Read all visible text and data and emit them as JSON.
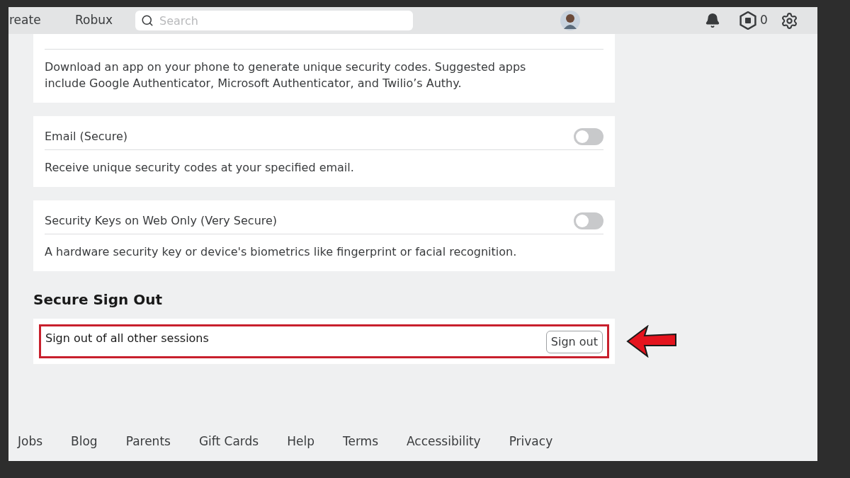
{
  "nav": {
    "items": [
      "reate",
      "Robux"
    ],
    "search": {
      "placeholder": "Search"
    },
    "robux_balance": "0"
  },
  "methods": [
    {
      "description": "Download an app on your phone to generate unique security codes. Suggested apps include Google Authenticator, Microsoft Authenticator, and Twilio’s Authy."
    },
    {
      "title": "Email (Secure)",
      "on": false,
      "description": "Receive unique security codes at your specified email."
    },
    {
      "title": "Security Keys on Web Only (Very Secure)",
      "on": false,
      "description": "A hardware security key or device's biometrics like fingerprint or facial recognition."
    }
  ],
  "secure_sign_out": {
    "heading": "Secure Sign Out",
    "label": "Sign out of all other sessions",
    "button": "Sign out",
    "highlighted": true
  },
  "footer_links": [
    "Jobs",
    "Blog",
    "Parents",
    "Gift Cards",
    "Help",
    "Terms",
    "Accessibility",
    "Privacy"
  ]
}
